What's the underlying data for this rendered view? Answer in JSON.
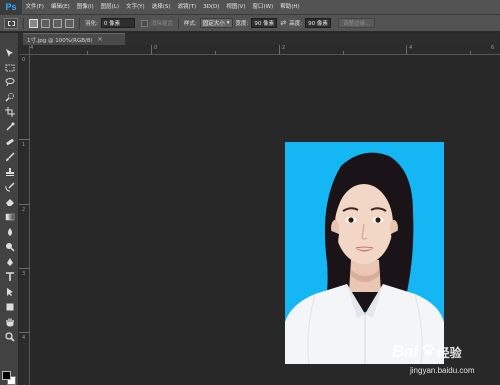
{
  "app": {
    "logo": "Ps"
  },
  "menu": [
    {
      "label": "文件(F)"
    },
    {
      "label": "编辑(E)"
    },
    {
      "label": "图像(I)"
    },
    {
      "label": "图层(L)"
    },
    {
      "label": "文字(Y)"
    },
    {
      "label": "选择(S)"
    },
    {
      "label": "滤镜(T)"
    },
    {
      "label": "3D(D)"
    },
    {
      "label": "视图(V)"
    },
    {
      "label": "窗口(W)"
    },
    {
      "label": "帮助(H)"
    }
  ],
  "options": {
    "feather_label": "羽化:",
    "feather_value": "0 像素",
    "antialias_label": "消除锯齿",
    "style_label": "样式:",
    "style_value": "固定大小",
    "width_label": "宽度:",
    "width_value": "90 像素",
    "height_label": "高度:",
    "height_value": "90 像素",
    "refine_edge": "调整边缘..."
  },
  "document": {
    "tab_title": "1寸.jpg @ 100%(RGB/8)",
    "close_glyph": "×"
  },
  "rulers": {
    "top": [
      "4",
      "0",
      "2",
      "4",
      "6"
    ],
    "left": [
      "0",
      "1",
      "2",
      "3",
      "4"
    ]
  },
  "tools": [
    {
      "name": "move-tool-icon"
    },
    {
      "name": "marquee-tool-icon"
    },
    {
      "name": "lasso-tool-icon"
    },
    {
      "name": "quick-selection-tool-icon"
    },
    {
      "name": "crop-tool-icon"
    },
    {
      "name": "eyedropper-tool-icon"
    },
    {
      "name": "healing-brush-tool-icon"
    },
    {
      "name": "brush-tool-icon"
    },
    {
      "name": "clone-stamp-tool-icon"
    },
    {
      "name": "history-brush-tool-icon"
    },
    {
      "name": "eraser-tool-icon"
    },
    {
      "name": "gradient-tool-icon"
    },
    {
      "name": "blur-tool-icon"
    },
    {
      "name": "dodge-tool-icon"
    },
    {
      "name": "pen-tool-icon"
    },
    {
      "name": "type-tool-icon"
    },
    {
      "name": "path-selection-tool-icon"
    },
    {
      "name": "shape-tool-icon"
    },
    {
      "name": "hand-tool-icon"
    },
    {
      "name": "zoom-tool-icon"
    }
  ],
  "colors": {
    "photo_background": "#14b7f3",
    "foreground": "#000000",
    "background": "#ffffff"
  },
  "watermark": {
    "brand": "Bai",
    "brand_suffix": "经验",
    "url": "jingyan.baidu.com"
  }
}
